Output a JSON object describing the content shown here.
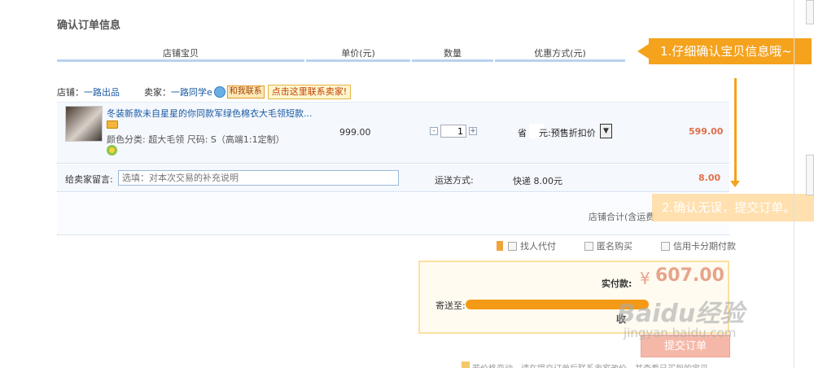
{
  "page_title": "确认订单信息",
  "table_headers": [
    "店铺宝贝",
    "单价(元)",
    "数量",
    "优惠方式(元)"
  ],
  "shop": {
    "shop_label": "店铺：",
    "shop_name": "一路出品",
    "seller_label": "卖家：",
    "seller_name": "一路同学e",
    "chat_label": "和我联系",
    "contact_label": "点击这里联系卖家!"
  },
  "item": {
    "title": "冬装新款未自星星的你同款军绿色棉衣大毛领短款...",
    "spec": "颜色分类: 超大毛领   尺码: S（高端1:1定制）",
    "price": "999.00",
    "qty_minus": "-",
    "qty_value": "1",
    "qty_plus": "+",
    "discount_prefix": "省",
    "discount_text": "元:预售折扣价",
    "discount_arrow": "▼",
    "subtotal": "599.00"
  },
  "message": {
    "label": "给卖家留言:",
    "placeholder": "选填：对本次交易的补充说明"
  },
  "shipping": {
    "label": "运送方式:",
    "method": "快递 8.00元",
    "fee": "8.00"
  },
  "shop_total_label": "店铺合计(含运费",
  "options": [
    "找人代付",
    "匿名购买",
    "信用卡分期付款"
  ],
  "payment": {
    "label": "实付款:",
    "currency": "¥",
    "amount": "607.00",
    "ship_to_label": "寄送至:",
    "receiver_label": "收"
  },
  "submit_label": "提交订单",
  "footnote": "若价格变动，请在提交订单后联系卖家改价，并查看已买到的宝贝",
  "callouts": {
    "step1": "1.仔细确认宝贝信息哦~",
    "step2": "2.确认无误，提交订单。"
  },
  "watermark": {
    "logo": "Baidu经验",
    "url": "jingyan.baidu.com"
  },
  "colors": {
    "accent_orange": "#f5a21d",
    "price_red": "#e0704a",
    "link_blue": "#1a5aa3",
    "header_border": "#b7d3ee"
  }
}
